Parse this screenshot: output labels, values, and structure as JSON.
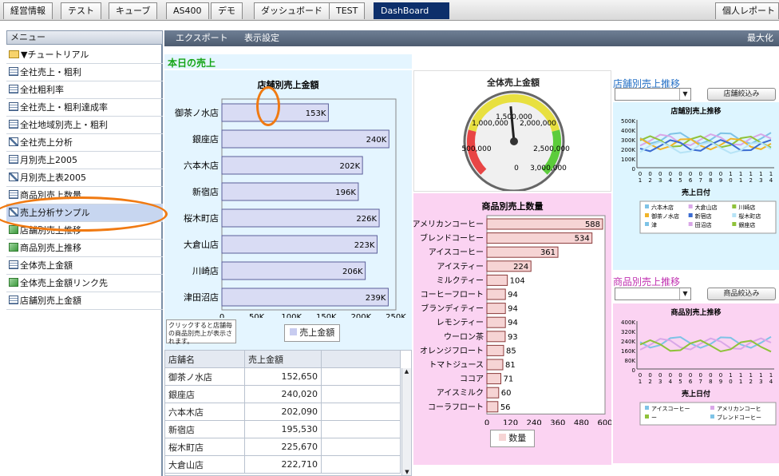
{
  "tabs": [
    {
      "label": "経営情報",
      "active": false
    },
    {
      "label": "テスト",
      "active": false
    },
    {
      "label": "キューブ",
      "active": false
    },
    {
      "label": "AS400",
      "active": false
    },
    {
      "label": "デモ",
      "active": false
    },
    {
      "label": "ダッシュボード",
      "active": false
    },
    {
      "label": "TEST",
      "active": false
    },
    {
      "label": "DashBoard",
      "active": true
    }
  ],
  "top_right_label": "個人レポート",
  "menu": {
    "header": "メニュー",
    "folder": "▼チュートリアル",
    "items": [
      {
        "label": "全社売上・粗利",
        "icon": "table-icon"
      },
      {
        "label": "全社粗利率",
        "icon": "table-icon"
      },
      {
        "label": "全社売上・粗利達成率",
        "icon": "table-icon"
      },
      {
        "label": "全社地域別売上・粗利",
        "icon": "table-icon"
      },
      {
        "label": "全社売上分析",
        "icon": "chart-icon"
      },
      {
        "label": "月別売上2005",
        "icon": "table-icon"
      },
      {
        "label": "月別売上表2005",
        "icon": "chart-icon"
      },
      {
        "label": "商品別売上数量",
        "icon": "table-icon"
      },
      {
        "label": "売上分析サンプル",
        "icon": "chart-icon",
        "selected": true
      },
      {
        "label": "店舗別売上推移",
        "icon": "org-chart-icon"
      },
      {
        "label": "商品別売上推移",
        "icon": "org-chart-icon"
      },
      {
        "label": "全体売上金額",
        "icon": "table-icon"
      },
      {
        "label": "全体売上金額リンク先",
        "icon": "org-chart-icon"
      },
      {
        "label": "店舗別売上金額",
        "icon": "table-icon"
      }
    ]
  },
  "toolbar": {
    "export": "エクスポート",
    "display_settings": "表示設定",
    "maximize": "最大化"
  },
  "section_title": "本日の売上",
  "store_chart_note": "クリックすると店舗毎の商品別売上が表示されます。",
  "table": {
    "headers": [
      "店舗名",
      "売上金額"
    ],
    "rows": [
      [
        "御茶ノ水店",
        "152,650"
      ],
      [
        "銀座店",
        "240,020"
      ],
      [
        "六本木店",
        "202,090"
      ],
      [
        "新宿店",
        "195,530"
      ],
      [
        "桜木町店",
        "225,670"
      ],
      [
        "大倉山店",
        "222,710"
      ]
    ]
  },
  "gauge": {
    "title": "全体売上金額",
    "labels": [
      "500,000",
      "1,000,000",
      "1,500,000",
      "2,000,000",
      "2,500,000",
      "3,000,000",
      "0"
    ],
    "value": 1440000
  },
  "trend1": {
    "title": "店舗別売上推移",
    "button": "店舗絞込み",
    "chart_title": "店舗別売上推移",
    "xlabel": "売上日付",
    "yticks": [
      "500K",
      "400K",
      "300K",
      "200K",
      "100K",
      "0"
    ],
    "xticks": [
      "0\n1",
      "0\n2",
      "0\n3",
      "0\n4",
      "0\n5",
      "0\n6",
      "0\n7",
      "0\n8",
      "0\n9",
      "1\n0",
      "1\n1",
      "1\n2",
      "1\n3",
      "1\n4"
    ],
    "legend": [
      "六本木店",
      "大倉山店",
      "川崎店",
      "御茶ノ水店",
      "新宿店",
      "桜木町店",
      "津",
      "田沼店",
      "銀座店"
    ]
  },
  "trend2": {
    "title": "商品別売上推移",
    "button": "商品絞込み",
    "chart_title": "商品別売上推移",
    "xlabel": "売上日付",
    "yticks": [
      "400K",
      "320K",
      "240K",
      "160K",
      "80K",
      "0"
    ],
    "legend": [
      "アイスコーヒー",
      "アメリカンコーヒ",
      "ー",
      "ブレンドコーヒー"
    ]
  },
  "colors": {
    "bar_fill": "#d9dcf4",
    "product_bar": "#f6d4d4",
    "store_panel_bg": "#e4f5ff",
    "product_panel_bg": "#fbd3f2",
    "trend_panel_bg": "#ddf5ff",
    "highlight": "#f07a12"
  },
  "chart_data": [
    {
      "type": "bar",
      "title": "店舗別売上金額",
      "categories": [
        "御茶ノ水店",
        "銀座店",
        "六本木店",
        "新宿店",
        "桜木町店",
        "大倉山店",
        "川崎店",
        "津田沼店"
      ],
      "values": [
        153,
        240,
        202,
        196,
        226,
        223,
        206,
        239
      ],
      "value_labels": [
        "153K",
        "240K",
        "202K",
        "196K",
        "226K",
        "223K",
        "206K",
        "239K"
      ],
      "xticks": [
        "0",
        "50K",
        "100K",
        "150K",
        "200K",
        "250K"
      ],
      "xlim": [
        0,
        250
      ],
      "legend": [
        "売上金額"
      ]
    },
    {
      "type": "bar",
      "title": "商品別売上数量",
      "categories": [
        "アメリカンコーヒー",
        "ブレンドコーヒー",
        "アイスコーヒー",
        "アイスティー",
        "ミルクティー",
        "コーヒーフロート",
        "ブランディティー",
        "レモンティー",
        "ウーロン茶",
        "オレンジフロート",
        "トマトジュース",
        "ココア",
        "アイスミルク",
        "コーラフロート"
      ],
      "values": [
        588,
        534,
        361,
        224,
        104,
        94,
        94,
        94,
        93,
        85,
        81,
        71,
        60,
        56
      ],
      "xticks": [
        "0",
        "120",
        "240",
        "360",
        "480",
        "600"
      ],
      "xlim": [
        0,
        600
      ],
      "legend": [
        "数量"
      ]
    }
  ]
}
